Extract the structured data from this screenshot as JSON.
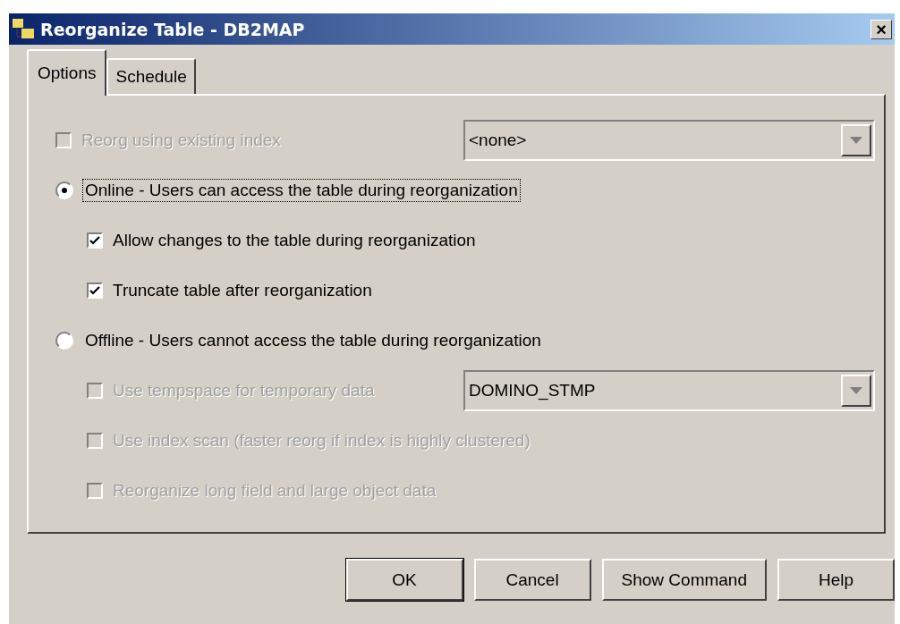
{
  "window": {
    "title": "Reorganize Table - DB2MAP",
    "close": "×"
  },
  "tabs": [
    {
      "label": "Options",
      "selected": true
    },
    {
      "label": "Schedule",
      "selected": false
    }
  ],
  "options": [
    {
      "kind": "checkbox",
      "label": "Reorg using existing index",
      "checked": false,
      "disabled": true,
      "dropdown": {
        "value": "<none>"
      }
    },
    {
      "kind": "radio",
      "label": "Online - Users can access the table during reorganization",
      "selected": true,
      "focused": true,
      "children": [
        {
          "kind": "checkbox",
          "label": "Allow changes to the table during reorganization",
          "checked": true,
          "disabled": false
        },
        {
          "kind": "checkbox",
          "label": "Truncate table after reorganization",
          "checked": true,
          "disabled": false
        }
      ]
    },
    {
      "kind": "radio",
      "label": "Offline - Users cannot access the table during reorganization",
      "selected": false,
      "focused": false,
      "children": [
        {
          "kind": "checkbox",
          "label": "Use tempspace for temporary data",
          "checked": false,
          "disabled": true,
          "dropdown": {
            "value": "DOMINO_STMP"
          }
        },
        {
          "kind": "checkbox",
          "label": "Use index scan (faster reorg if index is highly clustered)",
          "checked": false,
          "disabled": true
        },
        {
          "kind": "checkbox",
          "label": "Reorganize long field and large object data",
          "checked": false,
          "disabled": true
        }
      ]
    }
  ],
  "buttons": [
    {
      "label": "OK",
      "default": true
    },
    {
      "label": "Cancel",
      "default": false
    },
    {
      "label": "Show Command",
      "default": false
    },
    {
      "label": "Help",
      "default": false
    }
  ]
}
